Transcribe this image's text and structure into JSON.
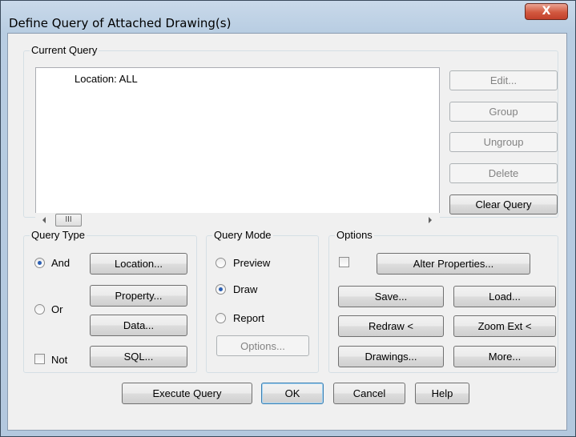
{
  "window": {
    "title": "Define Query of Attached Drawing(s)",
    "close_glyph": "X"
  },
  "current_query": {
    "label": "Current Query",
    "items": [
      "Location: ALL"
    ],
    "scroll_thumb": "III",
    "buttons": {
      "edit": "Edit...",
      "group": "Group",
      "ungroup": "Ungroup",
      "delete": "Delete",
      "clear": "Clear Query"
    }
  },
  "query_type": {
    "label": "Query Type",
    "and_label": "And",
    "and_checked": true,
    "or_label": "Or",
    "or_checked": false,
    "not_label": "Not",
    "not_checked": false,
    "buttons": {
      "location": "Location...",
      "property": "Property...",
      "data": "Data...",
      "sql": "SQL..."
    }
  },
  "query_mode": {
    "label": "Query Mode",
    "preview_label": "Preview",
    "draw_label": "Draw",
    "report_label": "Report",
    "selected": "Draw",
    "options_button": "Options..."
  },
  "options": {
    "label": "Options",
    "alter_checked": false,
    "buttons": {
      "alter": "Alter Properties...",
      "save": "Save...",
      "load": "Load...",
      "redraw": "Redraw <",
      "zoom_ext": "Zoom Ext <",
      "drawings": "Drawings...",
      "more": "More..."
    }
  },
  "footer": {
    "execute": "Execute Query",
    "ok": "OK",
    "cancel": "Cancel",
    "help": "Help"
  }
}
